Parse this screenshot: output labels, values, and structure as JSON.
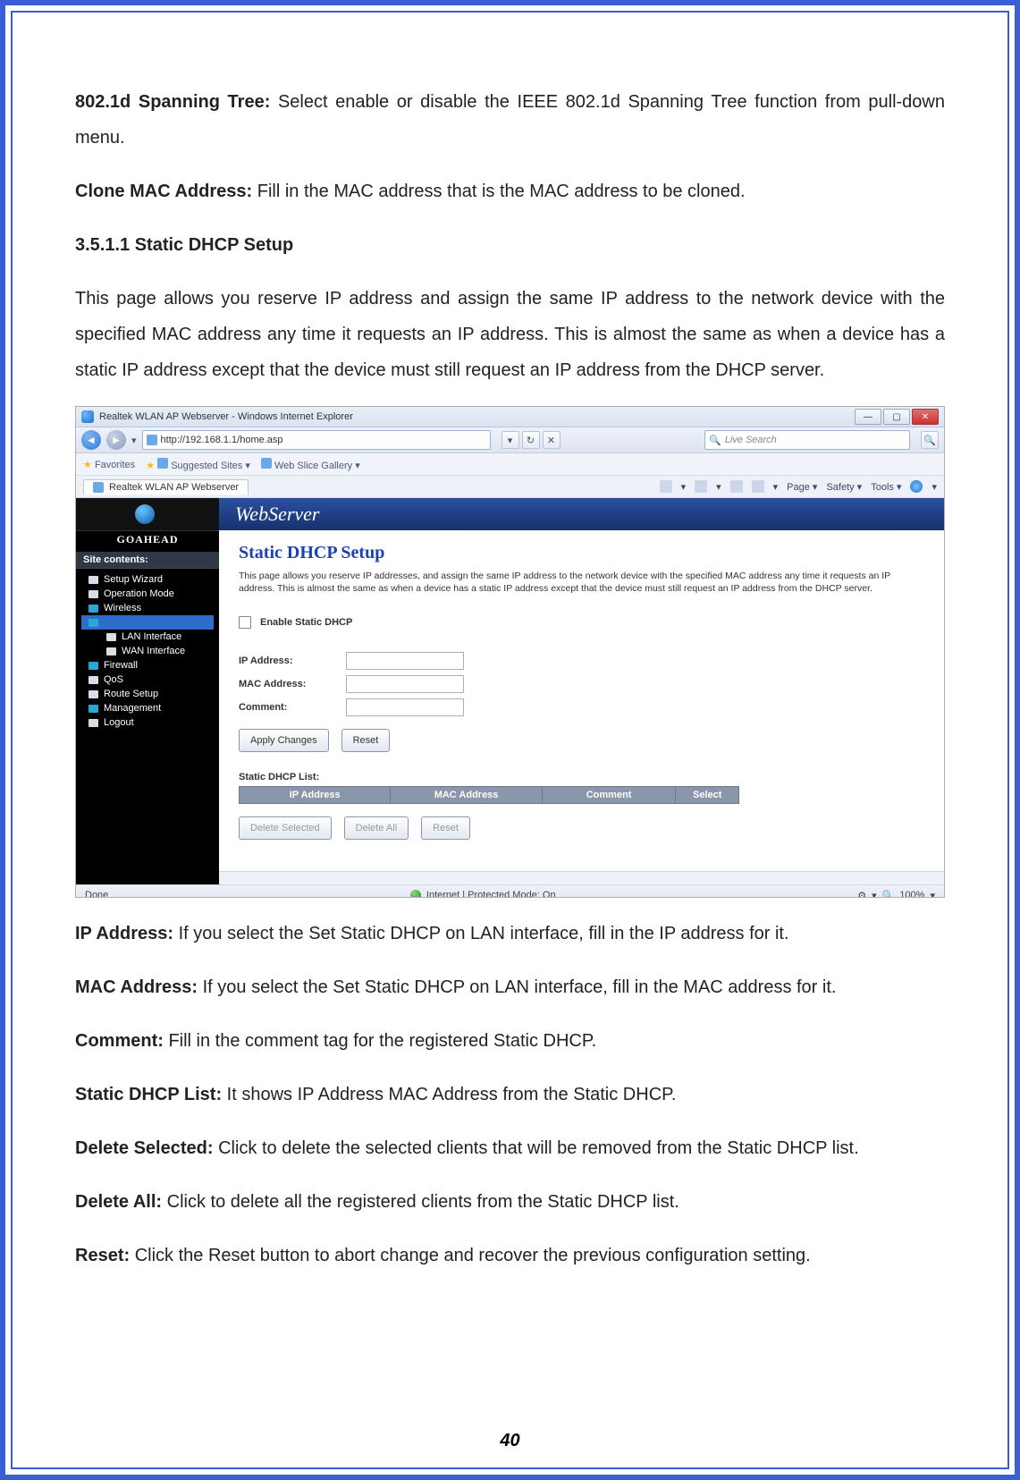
{
  "doc": {
    "p1a": "802.1d Spanning Tree:",
    "p1b": " Select enable or disable the IEEE 802.1d Spanning Tree function from pull-down menu.",
    "p2a": "Clone MAC Address:",
    "p2b": " Fill in the MAC address that is the MAC address to be cloned.",
    "section": "3.5.1.1  Static DHCP Setup",
    "p3": "This page allows you reserve IP address and assign the same IP address to the network device with the specified MAC address any time it requests an IP address. This is almost the same as when a device has a static IP address except that the device must still request an IP address from the DHCP server.",
    "p4a": "IP Address:",
    "p4b": " If you select the Set Static DHCP on LAN interface, fill in the IP address for it.",
    "p5a": "MAC Address:",
    "p5b": " If you select the Set Static DHCP on LAN interface, fill in the MAC address for it.",
    "p6a": "Comment:",
    "p6b": " Fill in the comment tag for the registered Static DHCP.",
    "p7a": "Static DHCP List:",
    "p7b": " It shows IP Address MAC Address from the Static DHCP.",
    "p8a": "Delete Selected:",
    "p8b": " Click to delete the selected clients that will be removed from the Static DHCP list.",
    "p9a": "Delete All:",
    "p9b": " Click to delete all the registered clients from the Static DHCP list.",
    "p10a": "Reset:",
    "p10b": " Click the Reset button to abort change and recover the previous configuration setting.",
    "pagenum": "40"
  },
  "browser": {
    "title": "Realtek WLAN AP Webserver - Windows Internet Explorer",
    "url": "http://192.168.1.1/home.asp",
    "search_placeholder": "Live Search",
    "favorites": "Favorites",
    "suggested": "Suggested Sites ▾",
    "slice": "Web Slice Gallery ▾",
    "tab": "Realtek WLAN AP Webserver",
    "cmd_page": "Page ▾",
    "cmd_safety": "Safety ▾",
    "cmd_tools": "Tools ▾",
    "status_left": "Done",
    "status_mid": "Internet | Protected Mode: On",
    "zoom": "100%"
  },
  "sidebar": {
    "brand": "GOAHEAD",
    "header": "Site contents:",
    "items": {
      "wizard": "Setup Wizard",
      "opmode": "Operation Mode",
      "wireless": "Wireless",
      "lan": "LAN Interface",
      "wan": "WAN Interface",
      "firewall": "Firewall",
      "qos": "QoS",
      "route": "Route Setup",
      "mgmt": "Management",
      "logout": "Logout"
    }
  },
  "page": {
    "banner": "WebServer",
    "title": "Static DHCP Setup",
    "desc": "This page allows you reserve IP addresses, and assign the same IP address to the network device with the specified MAC address any time it requests an IP address. This is almost the same as when a device has a static IP address except that the device must still request an IP address from the DHCP server.",
    "enable": "Enable Static DHCP",
    "ip_label": "IP Address:",
    "mac_label": "MAC Address:",
    "comment_label": "Comment:",
    "apply": "Apply Changes",
    "reset": "Reset",
    "list_label": "Static DHCP List:",
    "th_ip": "IP Address",
    "th_mac": "MAC Address",
    "th_comment": "Comment",
    "th_select": "Select",
    "del_sel": "Delete Selected",
    "del_all": "Delete All",
    "reset2": "Reset"
  }
}
